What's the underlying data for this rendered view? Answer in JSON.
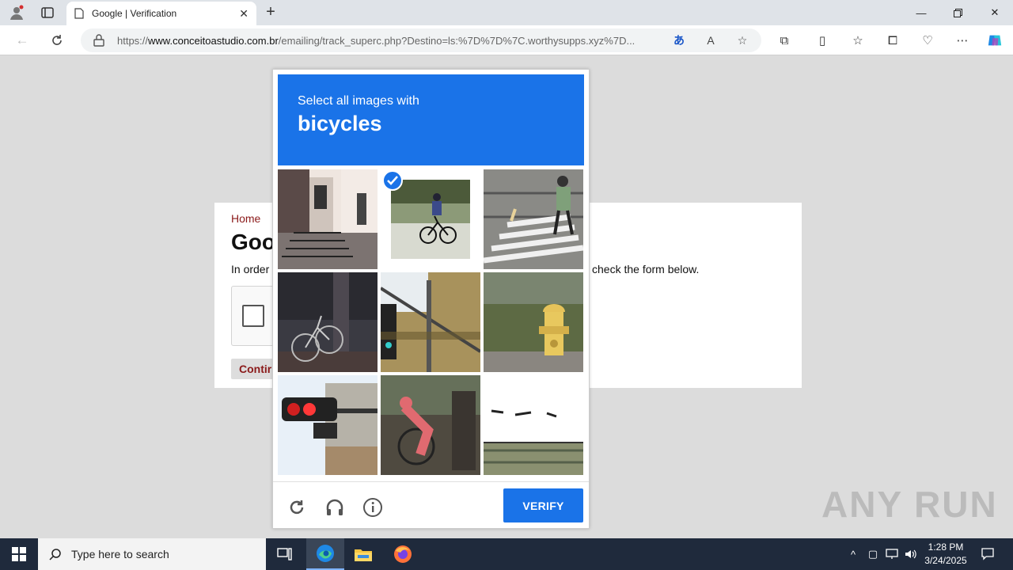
{
  "browser": {
    "tab_title": "Google | Verification",
    "url_prefix": "https://",
    "url_domain": "www.conceitoastudio.com.br",
    "url_path": "/emailing/track_superc.php?Destino=ls:%7D%7D%7C.worthysupps.xyz%7D..."
  },
  "page": {
    "home_link": "Home",
    "title": "Goo",
    "text_left": "In order",
    "text_right": "check the form below.",
    "continue_label": "Contir"
  },
  "captcha": {
    "instruction": "Select all images with",
    "target": "bicycles",
    "verify_label": "VERIFY",
    "accent_color": "#1a73e8",
    "tiles": [
      {
        "name": "building-steps",
        "selected": false
      },
      {
        "name": "cyclist-road",
        "selected": true
      },
      {
        "name": "crosswalk-pedestrian",
        "selected": false
      },
      {
        "name": "parked-bicycle",
        "selected": false
      },
      {
        "name": "traffic-light-pole",
        "selected": false
      },
      {
        "name": "fire-hydrant",
        "selected": false
      },
      {
        "name": "red-traffic-light",
        "selected": false
      },
      {
        "name": "bicycle-bushes",
        "selected": false
      },
      {
        "name": "snowy-field",
        "selected": false
      }
    ]
  },
  "watermark": "ANY RUN",
  "taskbar": {
    "search_placeholder": "Type here to search",
    "time": "1:28 PM",
    "date": "3/24/2025"
  }
}
